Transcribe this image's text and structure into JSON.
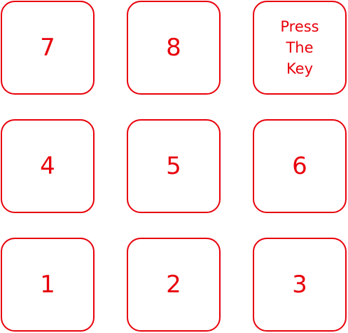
{
  "keypad": {
    "accent_color": "#e8000b",
    "keys": [
      {
        "label": "7"
      },
      {
        "label": "8"
      },
      {
        "label": "Press\nThe\nKey"
      },
      {
        "label": "4"
      },
      {
        "label": "5"
      },
      {
        "label": "6"
      },
      {
        "label": "1"
      },
      {
        "label": "2"
      },
      {
        "label": "3"
      }
    ]
  }
}
